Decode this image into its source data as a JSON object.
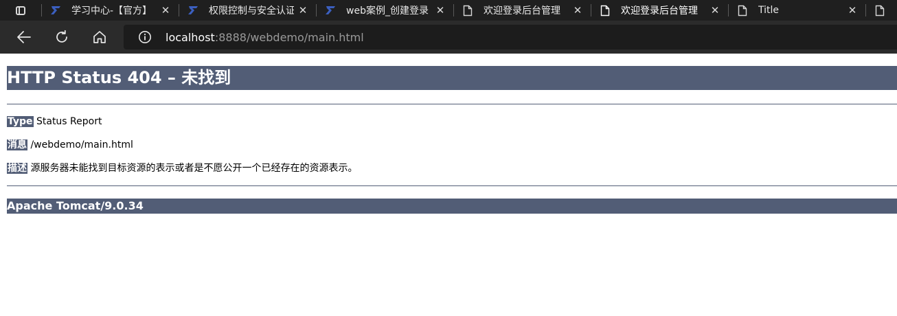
{
  "browser": {
    "tabs": [
      {
        "title": "学习中心-【官方】",
        "icon": "site-logo-icon",
        "active": false
      },
      {
        "title": "权限控制与安全认证",
        "icon": "site-logo-icon",
        "active": false
      },
      {
        "title": "web案例_创建登录",
        "icon": "site-logo-icon",
        "active": false
      },
      {
        "title": "欢迎登录后台管理",
        "icon": "page-icon",
        "active": false
      },
      {
        "title": "欢迎登录后台管理",
        "icon": "page-icon",
        "active": true
      },
      {
        "title": "Title",
        "icon": "page-icon",
        "active": false
      }
    ],
    "close_glyph": "✕",
    "url_host": "localhost",
    "url_rest": ":8888/webdemo/main.html"
  },
  "page": {
    "heading": "HTTP Status 404 – 未找到",
    "type_label": "Type",
    "type_value": "Status Report",
    "message_label": "消息",
    "message_value": "/webdemo/main.html",
    "description_label": "描述",
    "description_value": "源服务器未能找到目标资源的表示或者是不愿公开一个已经存在的资源表示。",
    "footer": "Apache Tomcat/9.0.34"
  },
  "colors": {
    "tomcat_header": "#525d76",
    "tabbar_bg": "#1f1f1f",
    "toolbar_bg": "#2b2b2b",
    "site_logo": "#3b5fbf"
  }
}
